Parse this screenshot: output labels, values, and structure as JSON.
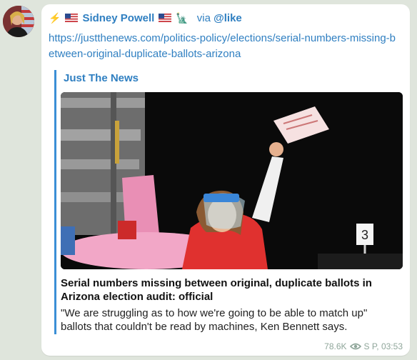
{
  "header": {
    "emoji_left": "⚡",
    "author": "Sidney Powell",
    "emoji_right": "🗽",
    "via_prefix": "via",
    "via_bot": "@like"
  },
  "message": {
    "url": "https://justthenews.com/politics-policy/elections/serial-numbers-missing-between-original-duplicate-ballots-arizona"
  },
  "preview": {
    "site_name": "Just The News",
    "title": "Serial numbers missing between original, duplicate ballots in Arizona election audit: official",
    "description": "\"We are struggling as to how we're going to be able to match up\" ballots that couldn't be read by machines, Ken Bennett says.",
    "image_sign_number": "3"
  },
  "footer": {
    "views": "78.6K",
    "signature_time": "S P, 03:53"
  },
  "colors": {
    "link": "#2f7fc1",
    "accent_bar": "#3b8fd6",
    "background": "#dfe5dc"
  }
}
